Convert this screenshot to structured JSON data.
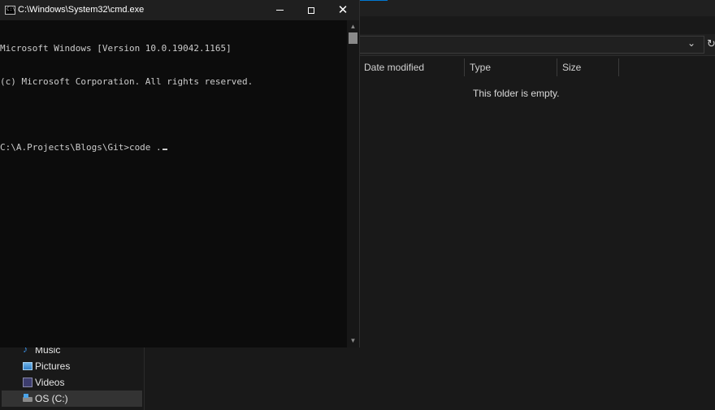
{
  "cmd": {
    "title": "C:\\Windows\\System32\\cmd.exe",
    "icon_glyph": "C:\\",
    "lines": [
      "Microsoft Windows [Version 10.0.19042.1165]",
      "(c) Microsoft Corporation. All rights reserved.",
      "",
      "C:\\A.Projects\\Blogs\\Git>code ."
    ],
    "controls": {
      "minimize": "minimize",
      "maximize": "maximize",
      "close": "✕"
    }
  },
  "explorer": {
    "columns": {
      "date_modified": "Date modified",
      "type": "Type",
      "size": "Size"
    },
    "empty_message": "This folder is empty.",
    "nav": {
      "music": "Music",
      "pictures": "Pictures",
      "videos": "Videos",
      "os_drive": "OS (C:)"
    },
    "glyphs": {
      "dropdown": "⌄",
      "refresh": "↻",
      "music_note": "♪"
    }
  },
  "colors": {
    "console_bg": "#0c0c0c",
    "console_text": "#cccccc",
    "explorer_bg": "#191919",
    "accent": "#0078d4"
  }
}
